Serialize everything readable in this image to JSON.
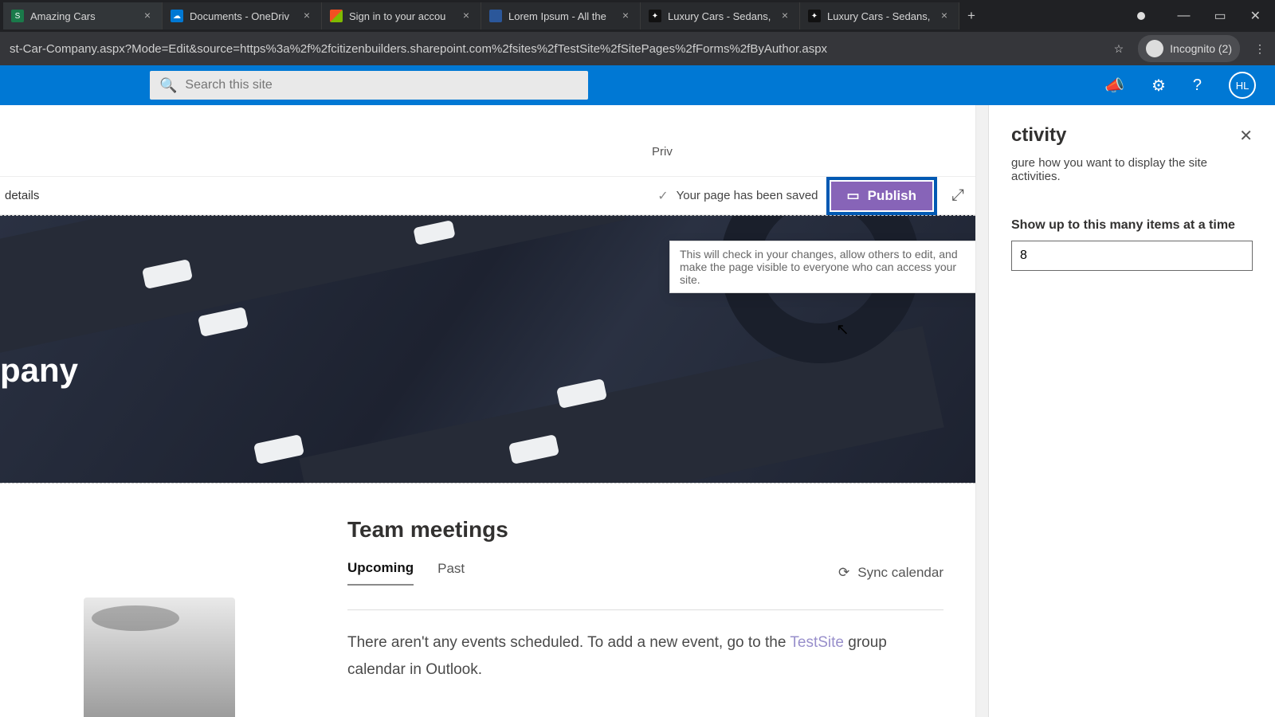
{
  "browser": {
    "tabs": [
      {
        "title": "Amazing Cars"
      },
      {
        "title": "Documents - OneDriv"
      },
      {
        "title": "Sign in to your accou"
      },
      {
        "title": "Lorem Ipsum - All the"
      },
      {
        "title": "Luxury Cars - Sedans,"
      },
      {
        "title": "Luxury Cars - Sedans,"
      }
    ],
    "url": "st-Car-Company.aspx?Mode=Edit&source=https%3a%2f%2fcitizenbuilders.sharepoint.com%2fsites%2fTestSite%2fSitePages%2fForms%2fByAuthor.aspx",
    "incognito_label": "Incognito (2)"
  },
  "search": {
    "placeholder": "Search this site"
  },
  "avatar": {
    "initials": "HL"
  },
  "privacy_label": "Priv",
  "details_label": "details",
  "saved_message": "Your page has been saved",
  "publish_label": "Publish",
  "tooltip": "This will check in your changes, allow others to edit, and make the page visible to everyone who can access your site.",
  "hero_title": "pany",
  "events": {
    "heading": "Team meetings",
    "tab_upcoming": "Upcoming",
    "tab_past": "Past",
    "sync_label": "Sync calendar",
    "empty_prefix": "There aren't any events scheduled. To add a new event, go to the ",
    "empty_link": "TestSite",
    "empty_suffix": " group calendar in Outlook."
  },
  "panel": {
    "title": "ctivity",
    "desc": "gure how you want to display the site activities.",
    "items_label": "Show up to this many items at a time",
    "items_value": "8"
  }
}
